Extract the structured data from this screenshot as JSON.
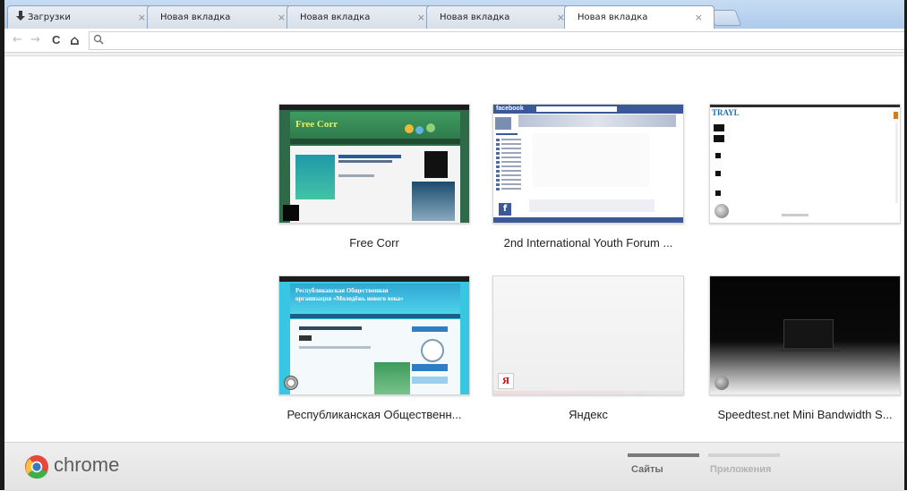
{
  "tabs": [
    {
      "label": "Загрузки",
      "close": "×",
      "active": false,
      "icon": "download-icon"
    },
    {
      "label": "Новая вкладка",
      "close": "×",
      "active": false
    },
    {
      "label": "Новая вкладка",
      "close": "×",
      "active": false
    },
    {
      "label": "Новая вкладка",
      "close": "×",
      "active": false
    },
    {
      "label": "Новая вкладка",
      "close": "×",
      "active": true
    }
  ],
  "toolbar": {
    "back": "←",
    "forward": "→",
    "reload": "C",
    "home": "⌂",
    "omnibox_value": ""
  },
  "most_visited": [
    {
      "title": "Free Corr",
      "thumb_text": "Free Corr"
    },
    {
      "title": "2nd International Youth Forum ...",
      "thumb_text": "facebook"
    },
    {
      "title": "",
      "thumb_text": "TRAYL"
    },
    {
      "title": "Республиканская Общественн...",
      "thumb_text": "Республиканская Общественная организация «Молодёжь нового века»"
    },
    {
      "title": "Яндекс",
      "thumb_text": "Я"
    },
    {
      "title": "Speedtest.net Mini Bandwidth S...",
      "thumb_text": ""
    }
  ],
  "footer": {
    "brand": "chrome",
    "sections": [
      {
        "label": "Сайты",
        "active": true
      },
      {
        "label": "Приложения",
        "active": false
      }
    ]
  },
  "colors": {
    "tabstrip": "#b8d2ee",
    "freecorr_green": "#3c8a56",
    "facebook_blue": "#3b5998",
    "republic_cyan": "#3ecbe6"
  }
}
